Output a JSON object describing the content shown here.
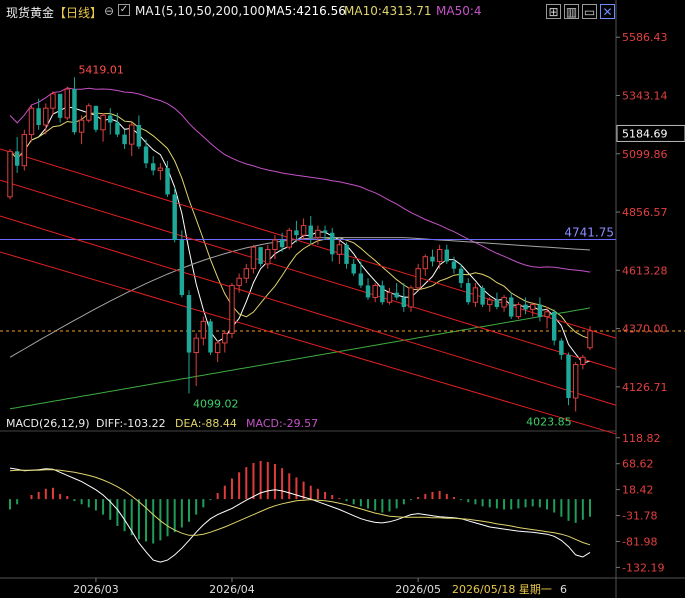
{
  "header": {
    "title": "现货黄金",
    "period": "【日线】",
    "ma_label": "MA1(5,10,50,200,100)",
    "ma5": "MA5:4216.56",
    "ma10": "MA10:4313.71",
    "ma50": "MA50:4",
    "zoom_icon": "zoom-out-icon",
    "toolbar_icons": [
      "grid-icon",
      "bar-chart-icon",
      "window-icon",
      "close-icon"
    ]
  },
  "colors": {
    "up": "#d93f3f",
    "down": "#1fa89a",
    "ma5": "#ffffff",
    "ma10": "#e0d46a",
    "ma50": "#c552c8",
    "ma100": "#a4a4a4",
    "ma200": "#3eaa3e",
    "channel": "#e02020",
    "hline": "#6a6aff",
    "price_line": "#f0a020",
    "macd_up": "#e03c3c",
    "macd_down": "#1f9e5a"
  },
  "price_axis": [
    "5586.43",
    "5343.14",
    "5099.86",
    "4856.57",
    "4613.28",
    "4370.00",
    "4126.71"
  ],
  "price_tag": "5184.69",
  "hline_label": "4741.75",
  "annotations": {
    "high": "5419.01",
    "low1": "4099.02",
    "low2": "4023.85"
  },
  "macd_header": {
    "label": "MACD(26,12,9)",
    "diff": "DIFF:-103.22",
    "dea": "DEA:-88.44",
    "macd": "MACD:-29.57"
  },
  "macd_axis": [
    "118.82",
    "68.62",
    "18.42",
    "-31.78",
    "-81.98",
    "-132.19"
  ],
  "x_axis": {
    "ticks": [
      "2026/03",
      "2026/04",
      "2026/05"
    ],
    "cursor_date": "2026/05/18 星期一",
    "cursor_suffix": "6"
  },
  "chart_data": {
    "type": "candlestick",
    "y_range": [
      4030,
      5650
    ],
    "candles": [
      [
        4920,
        5120,
        4910,
        5110
      ],
      [
        5110,
        5170,
        5020,
        5050
      ],
      [
        5050,
        5200,
        5030,
        5180
      ],
      [
        5180,
        5300,
        5150,
        5290
      ],
      [
        5290,
        5330,
        5200,
        5220
      ],
      [
        5220,
        5310,
        5180,
        5290
      ],
      [
        5290,
        5360,
        5260,
        5350
      ],
      [
        5350,
        5330,
        5230,
        5250
      ],
      [
        5250,
        5380,
        5240,
        5370
      ],
      [
        5370,
        5419,
        5180,
        5190
      ],
      [
        5190,
        5260,
        5140,
        5240
      ],
      [
        5240,
        5310,
        5230,
        5300
      ],
      [
        5300,
        5290,
        5190,
        5200
      ],
      [
        5200,
        5270,
        5150,
        5260
      ],
      [
        5260,
        5290,
        5180,
        5230
      ],
      [
        5230,
        5270,
        5170,
        5180
      ],
      [
        5180,
        5200,
        5120,
        5140
      ],
      [
        5140,
        5230,
        5090,
        5220
      ],
      [
        5220,
        5260,
        5120,
        5130
      ],
      [
        5130,
        5160,
        5040,
        5060
      ],
      [
        5060,
        5090,
        5010,
        5030
      ],
      [
        5030,
        5060,
        4990,
        5040
      ],
      [
        5040,
        5070,
        4920,
        4930
      ],
      [
        4930,
        4960,
        4730,
        4740
      ],
      [
        4740,
        4780,
        4500,
        4510
      ],
      [
        4510,
        4530,
        4099,
        4270
      ],
      [
        4270,
        4350,
        4130,
        4330
      ],
      [
        4330,
        4420,
        4300,
        4400
      ],
      [
        4400,
        4410,
        4260,
        4270
      ],
      [
        4270,
        4320,
        4230,
        4310
      ],
      [
        4310,
        4360,
        4270,
        4350
      ],
      [
        4350,
        4560,
        4330,
        4550
      ],
      [
        4550,
        4600,
        4520,
        4580
      ],
      [
        4580,
        4640,
        4560,
        4620
      ],
      [
        4620,
        4720,
        4600,
        4710
      ],
      [
        4710,
        4710,
        4630,
        4640
      ],
      [
        4640,
        4720,
        4620,
        4700
      ],
      [
        4700,
        4760,
        4660,
        4740
      ],
      [
        4740,
        4770,
        4690,
        4710
      ],
      [
        4710,
        4790,
        4700,
        4780
      ],
      [
        4780,
        4820,
        4730,
        4760
      ],
      [
        4760,
        4830,
        4740,
        4800
      ],
      [
        4800,
        4840,
        4720,
        4750
      ],
      [
        4750,
        4800,
        4720,
        4780
      ],
      [
        4780,
        4800,
        4740,
        4770
      ],
      [
        4770,
        4790,
        4650,
        4680
      ],
      [
        4680,
        4740,
        4640,
        4720
      ],
      [
        4720,
        4730,
        4620,
        4640
      ],
      [
        4640,
        4660,
        4590,
        4600
      ],
      [
        4600,
        4650,
        4540,
        4550
      ],
      [
        4550,
        4580,
        4490,
        4500
      ],
      [
        4500,
        4560,
        4480,
        4550
      ],
      [
        4550,
        4570,
        4470,
        4480
      ],
      [
        4480,
        4540,
        4470,
        4520
      ],
      [
        4520,
        4560,
        4490,
        4500
      ],
      [
        4500,
        4560,
        4440,
        4460
      ],
      [
        4460,
        4550,
        4440,
        4540
      ],
      [
        4540,
        4640,
        4530,
        4620
      ],
      [
        4620,
        4680,
        4590,
        4670
      ],
      [
        4670,
        4700,
        4630,
        4650
      ],
      [
        4650,
        4720,
        4620,
        4700
      ],
      [
        4700,
        4720,
        4640,
        4650
      ],
      [
        4650,
        4670,
        4600,
        4620
      ],
      [
        4620,
        4640,
        4540,
        4560
      ],
      [
        4560,
        4580,
        4470,
        4480
      ],
      [
        4480,
        4560,
        4460,
        4540
      ],
      [
        4540,
        4550,
        4460,
        4470
      ],
      [
        4470,
        4500,
        4440,
        4490
      ],
      [
        4490,
        4520,
        4450,
        4460
      ],
      [
        4460,
        4510,
        4440,
        4500
      ],
      [
        4500,
        4520,
        4410,
        4420
      ],
      [
        4420,
        4480,
        4410,
        4470
      ],
      [
        4470,
        4500,
        4430,
        4450
      ],
      [
        4450,
        4480,
        4420,
        4470
      ],
      [
        4470,
        4500,
        4400,
        4420
      ],
      [
        4420,
        4460,
        4370,
        4440
      ],
      [
        4440,
        4450,
        4300,
        4320
      ],
      [
        4320,
        4330,
        4240,
        4260
      ],
      [
        4260,
        4270,
        4050,
        4080
      ],
      [
        4080,
        4230,
        4023.85,
        4220
      ],
      [
        4220,
        4260,
        4200,
        4250
      ],
      [
        4290,
        4380,
        4280,
        4360
      ]
    ],
    "macd": {
      "hist": [
        -20,
        -10,
        0,
        8,
        14,
        20,
        22,
        10,
        6,
        -4,
        -10,
        -16,
        -22,
        -30,
        -40,
        -52,
        -62,
        -70,
        -78,
        -82,
        -86,
        -80,
        -72,
        -64,
        -55,
        -44,
        -30,
        -16,
        -2,
        12,
        26,
        40,
        52,
        62,
        70,
        74,
        72,
        68,
        60,
        50,
        42,
        34,
        26,
        20,
        14,
        8,
        2,
        -4,
        -10,
        -14,
        -18,
        -22,
        -26,
        -24,
        -18,
        -10,
        -2,
        4,
        10,
        14,
        16,
        10,
        4,
        -2,
        -6,
        -10,
        -14,
        -16,
        -18,
        -20,
        -20,
        -18,
        -16,
        -14,
        -16,
        -20,
        -26,
        -34,
        -42,
        -46,
        -40,
        -34
      ],
      "diff": [
        60,
        58,
        55,
        56,
        57,
        59,
        58,
        52,
        46,
        40,
        34,
        26,
        18,
        8,
        -5,
        -20,
        -40,
        -62,
        -85,
        -102,
        -118,
        -122,
        -118,
        -108,
        -95,
        -80,
        -64,
        -50,
        -38,
        -30,
        -24,
        -18,
        -10,
        -2,
        5,
        12,
        16,
        18,
        16,
        12,
        8,
        4,
        0,
        -5,
        -10,
        -15,
        -20,
        -26,
        -32,
        -38,
        -42,
        -45,
        -46,
        -44,
        -40,
        -35,
        -30,
        -28,
        -30,
        -32,
        -34,
        -35,
        -36,
        -38,
        -42,
        -46,
        -50,
        -54,
        -56,
        -58,
        -60,
        -62,
        -63,
        -64,
        -66,
        -68,
        -72,
        -80,
        -92,
        -108,
        -112,
        -103.22
      ],
      "dea": [
        55,
        56,
        56,
        56,
        56,
        57,
        57,
        56,
        54,
        52,
        49,
        46,
        42,
        37,
        31,
        24,
        16,
        6,
        -5,
        -17,
        -30,
        -42,
        -52,
        -60,
        -66,
        -70,
        -70,
        -68,
        -64,
        -59,
        -54,
        -48,
        -42,
        -36,
        -30,
        -24,
        -18,
        -13,
        -9,
        -6,
        -3,
        -2,
        -1,
        -2,
        -3,
        -5,
        -8,
        -11,
        -15,
        -19,
        -23,
        -27,
        -30,
        -33,
        -34,
        -35,
        -35,
        -35,
        -35,
        -36,
        -36,
        -37,
        -37,
        -38,
        -39,
        -41,
        -43,
        -45,
        -48,
        -50,
        -52,
        -55,
        -57,
        -59,
        -61,
        -63,
        -65,
        -68,
        -72,
        -78,
        -84,
        -88.44
      ],
      "y_range": [
        -145,
        130
      ]
    }
  }
}
